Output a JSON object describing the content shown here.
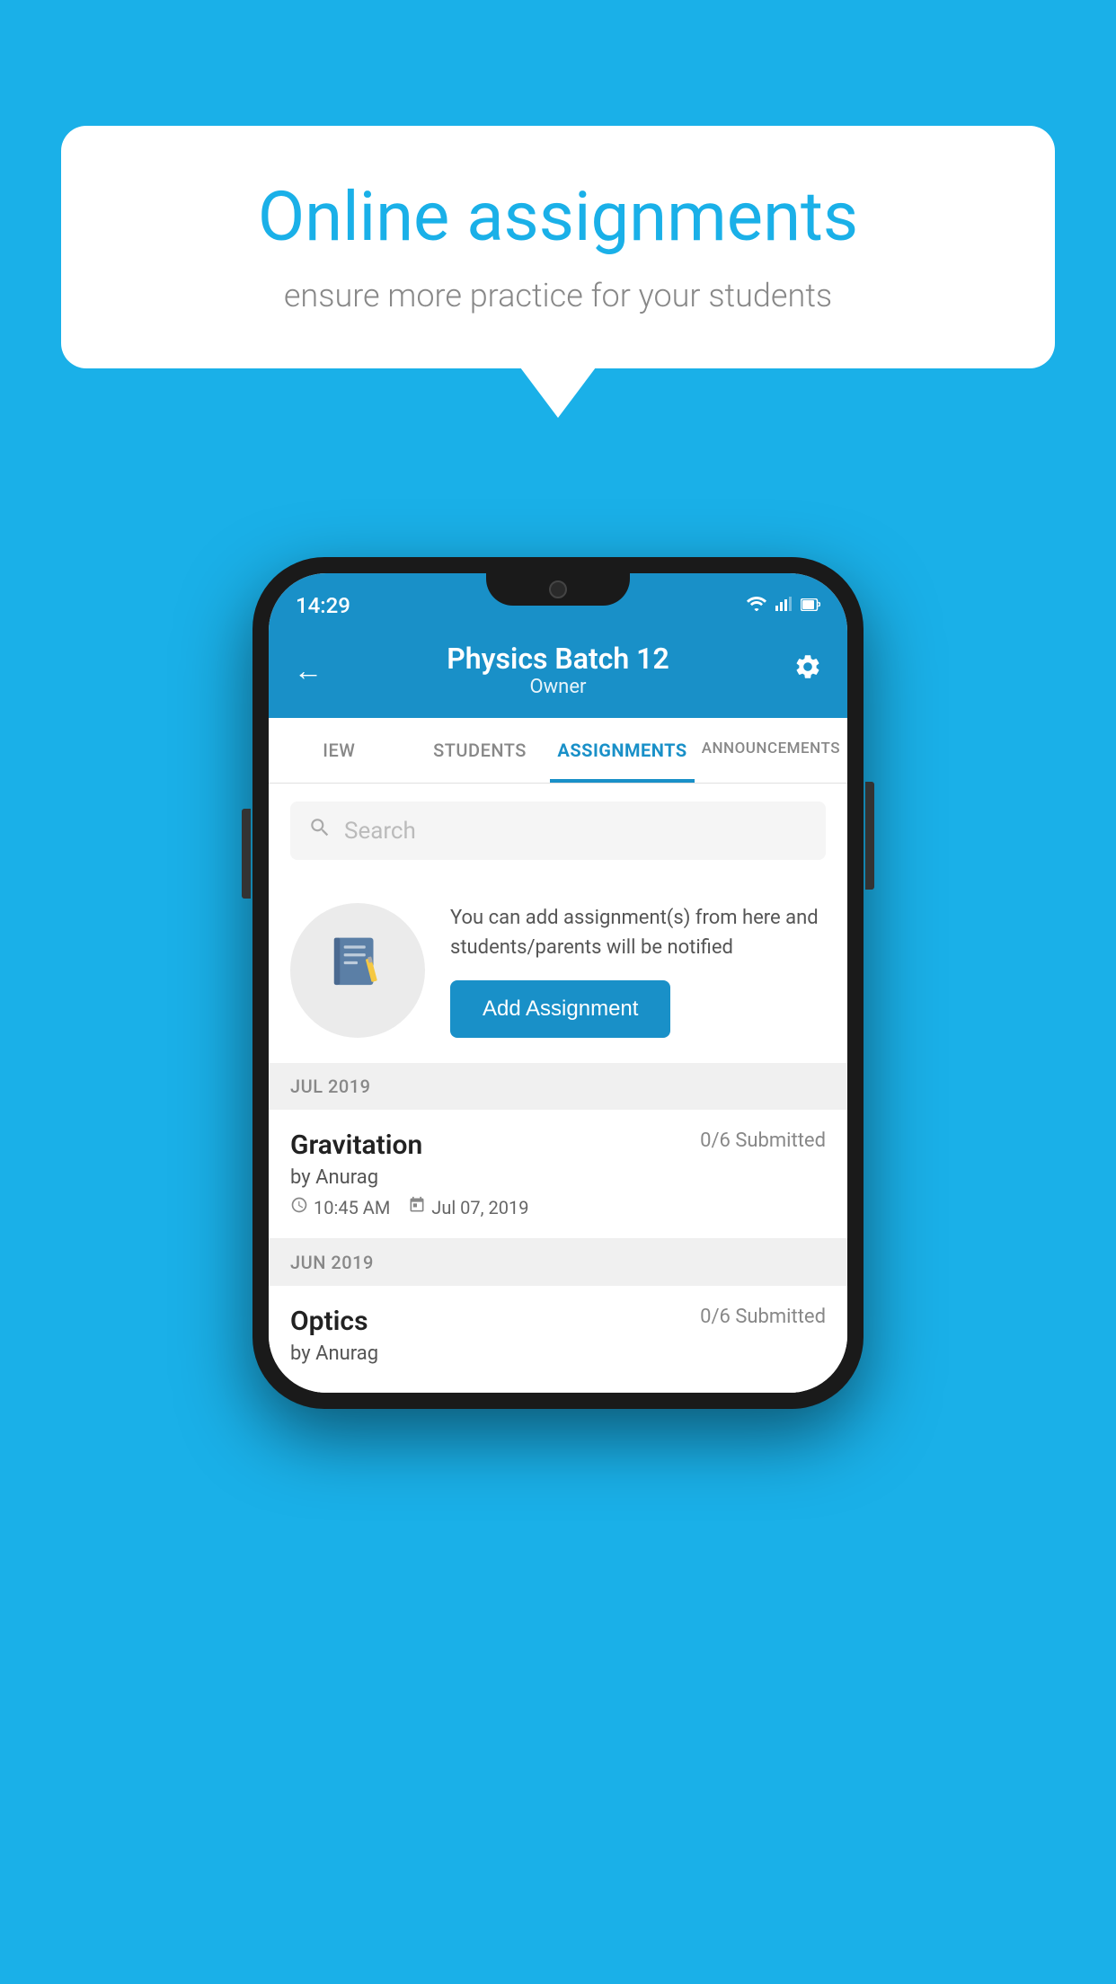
{
  "background_color": "#1ab0e8",
  "speech_bubble": {
    "title": "Online assignments",
    "subtitle": "ensure more practice for your students"
  },
  "phone": {
    "status_bar": {
      "time": "14:29",
      "wifi": "▼",
      "signal": "▲",
      "battery": "▐"
    },
    "header": {
      "title": "Physics Batch 12",
      "subtitle": "Owner",
      "back_label": "←",
      "settings_label": "⚙"
    },
    "tabs": [
      {
        "label": "IEW",
        "active": false
      },
      {
        "label": "STUDENTS",
        "active": false
      },
      {
        "label": "ASSIGNMENTS",
        "active": true
      },
      {
        "label": "ANNOUNCEMENTS",
        "active": false
      }
    ],
    "search": {
      "placeholder": "Search"
    },
    "info_section": {
      "description": "You can add assignment(s) from here and students/parents will be notified",
      "button_label": "Add Assignment"
    },
    "sections": [
      {
        "month": "JUL 2019",
        "assignments": [
          {
            "title": "Gravitation",
            "submitted": "0/6 Submitted",
            "author": "by Anurag",
            "time": "10:45 AM",
            "date": "Jul 07, 2019"
          }
        ]
      },
      {
        "month": "JUN 2019",
        "assignments": [
          {
            "title": "Optics",
            "submitted": "0/6 Submitted",
            "author": "by Anurag",
            "time": "",
            "date": ""
          }
        ]
      }
    ]
  }
}
